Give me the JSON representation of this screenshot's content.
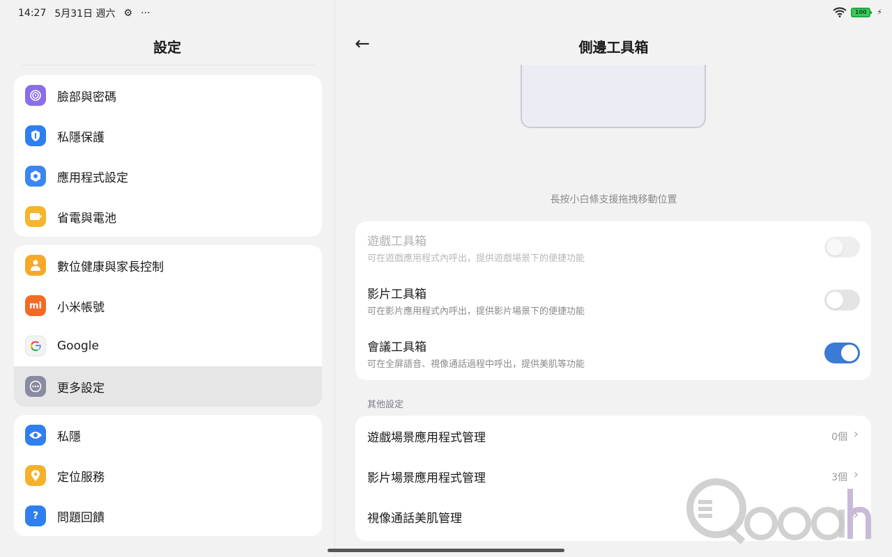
{
  "status_bar": {
    "time": "14:27",
    "date": "5月31日 週六",
    "more": "···",
    "battery": "100",
    "icons": [
      "settings-gear-icon",
      "wifi-icon",
      "battery-icon",
      "charging-icon"
    ]
  },
  "left": {
    "title": "設定",
    "groups": [
      [
        {
          "label": "臉部與密碼",
          "icon": "fingerprint-icon",
          "color": "#8b6de8"
        },
        {
          "label": "私隱保護",
          "icon": "privacy-shield-icon",
          "color": "#2f7ff0"
        },
        {
          "label": "應用程式設定",
          "icon": "app-settings-icon",
          "color": "#3b86f2"
        },
        {
          "label": "省電與電池",
          "icon": "battery-saver-icon",
          "color": "#f4b62b"
        }
      ],
      [
        {
          "label": "數位健康與家長控制",
          "icon": "wellbeing-icon",
          "color": "#f6a928"
        },
        {
          "label": "小米帳號",
          "icon": "mi-account-icon",
          "color": "#f26a26"
        },
        {
          "label": "Google",
          "icon": "google-icon",
          "color": "#ffffff"
        },
        {
          "label": "更多設定",
          "icon": "more-settings-icon",
          "color": "#8a8aa0"
        }
      ],
      [
        {
          "label": "私隱",
          "icon": "eye-icon",
          "color": "#2f7ff0"
        },
        {
          "label": "定位服務",
          "icon": "location-icon",
          "color": "#f6b02a"
        },
        {
          "label": "問題回饋",
          "icon": "feedback-icon",
          "color": "#2f7ff0"
        }
      ]
    ]
  },
  "right": {
    "title": "側邊工具箱",
    "hint": "長按小白條支援拖拽移動位置",
    "toggles": [
      {
        "title": "遊戲工具箱",
        "desc": "可在遊戲應用程式內呼出，提供遊戲場景下的便捷功能",
        "state": "disabled"
      },
      {
        "title": "影片工具箱",
        "desc": "可在影片應用程式內呼出，提供影片場景下的便捷功能",
        "state": "off"
      },
      {
        "title": "會議工具箱",
        "desc": "可在全屏語音、視像通話過程中呼出，提供美肌等功能",
        "state": "on"
      }
    ],
    "section_label": "其他設定",
    "nav_items": [
      {
        "title": "遊戲場景應用程式管理",
        "value": "0個"
      },
      {
        "title": "影片場景應用程式管理",
        "value": "3個"
      },
      {
        "title": "視像通話美肌管理",
        "value": ""
      }
    ]
  },
  "watermark": "Qooah",
  "colors": {
    "accent": "#3a7bd5",
    "selected_row": "#e6e6e6",
    "background": "#f2f2f2"
  }
}
